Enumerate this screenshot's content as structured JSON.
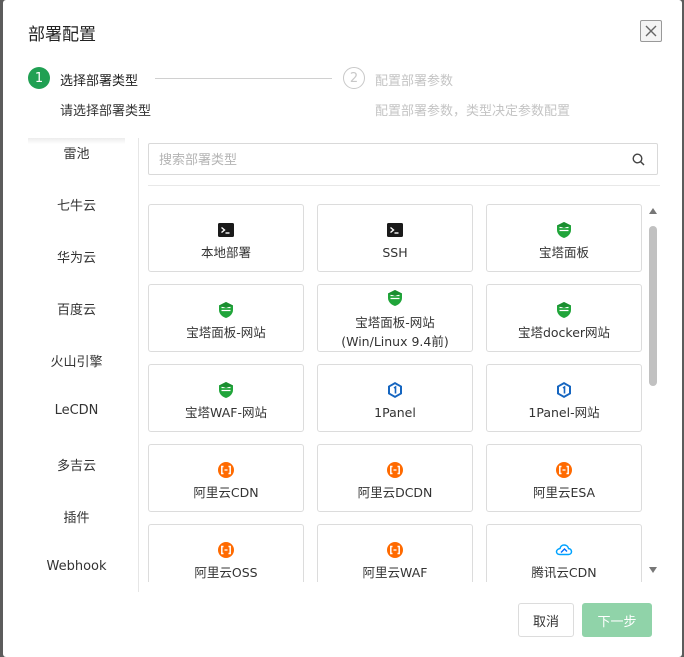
{
  "dialog": {
    "title": "部署配置"
  },
  "steps": [
    {
      "number": "1",
      "title": "选择部署类型",
      "desc": "请选择部署类型"
    },
    {
      "number": "2",
      "title": "配置部署参数",
      "desc": "配置部署参数，类型决定参数配置"
    }
  ],
  "sidebar": {
    "items": [
      {
        "label": "雷池"
      },
      {
        "label": "七牛云"
      },
      {
        "label": "华为云"
      },
      {
        "label": "百度云"
      },
      {
        "label": "火山引擎"
      },
      {
        "label": "LeCDN"
      },
      {
        "label": "多吉云"
      },
      {
        "label": "插件"
      },
      {
        "label": "Webhook"
      }
    ]
  },
  "search": {
    "placeholder": "搜索部署类型",
    "value": ""
  },
  "cards": [
    {
      "icon": "terminal-icon",
      "label": "本地部署"
    },
    {
      "icon": "terminal-icon",
      "label": "SSH"
    },
    {
      "icon": "baota-icon",
      "label": "宝塔面板"
    },
    {
      "icon": "baota-icon",
      "label": "宝塔面板-网站"
    },
    {
      "icon": "baota-icon",
      "label": "宝塔面板-网站",
      "label2": "(Win/Linux 9.4前)"
    },
    {
      "icon": "baota-icon",
      "label": "宝塔docker网站"
    },
    {
      "icon": "baota-icon",
      "label": "宝塔WAF-网站"
    },
    {
      "icon": "onepanel-icon",
      "label": "1Panel"
    },
    {
      "icon": "onepanel-icon",
      "label": "1Panel-网站"
    },
    {
      "icon": "aliyun-icon",
      "label": "阿里云CDN"
    },
    {
      "icon": "aliyun-icon",
      "label": "阿里云DCDN"
    },
    {
      "icon": "aliyun-icon",
      "label": "阿里云ESA"
    },
    {
      "icon": "aliyun-icon",
      "label": "阿里云OSS"
    },
    {
      "icon": "aliyun-icon",
      "label": "阿里云WAF"
    },
    {
      "icon": "tencent-cloud-icon",
      "label": "腾讯云CDN"
    }
  ],
  "footer": {
    "cancel_label": "取消",
    "next_label": "下一步"
  },
  "colors": {
    "primary": "#20a053",
    "primary_disabled": "#90d3a9",
    "aliyun": "#ff6a00",
    "onepanel": "#1565c0"
  }
}
